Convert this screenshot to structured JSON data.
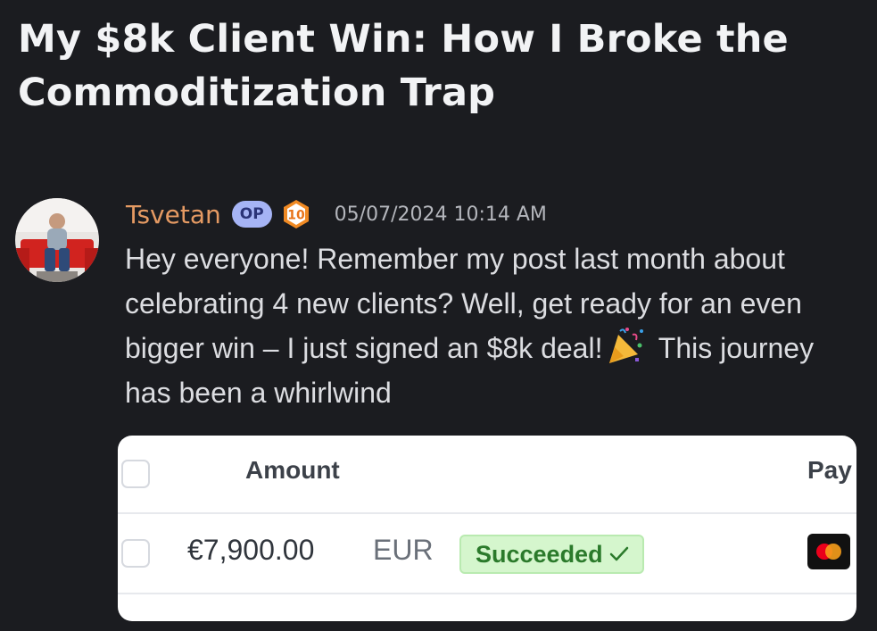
{
  "post": {
    "title": "My $8k Client Win: How I Broke the Commoditization Trap"
  },
  "message": {
    "author": "Tsvetan",
    "op_badge": "OP",
    "level": "10",
    "timestamp": "05/07/2024 10:14 AM",
    "text_before_emoji": "Hey everyone! Remember my post last month about celebrating 4 new clients? Well, get ready for an even bigger win – I just signed an $8k deal!",
    "text_after_emoji": "This journey has been a whirlwind",
    "emoji": "party-popper-icon"
  },
  "payment_table": {
    "header_amount": "Amount",
    "header_payment": "Pay",
    "row": {
      "amount": "€7,900.00",
      "currency": "EUR",
      "status": "Succeeded"
    }
  },
  "colors": {
    "background": "#1b1c20",
    "author": "#e59a63",
    "op_badge": "#a6b4f5",
    "level_badge": "#f08a24",
    "status_green": "#2b7a2b"
  }
}
